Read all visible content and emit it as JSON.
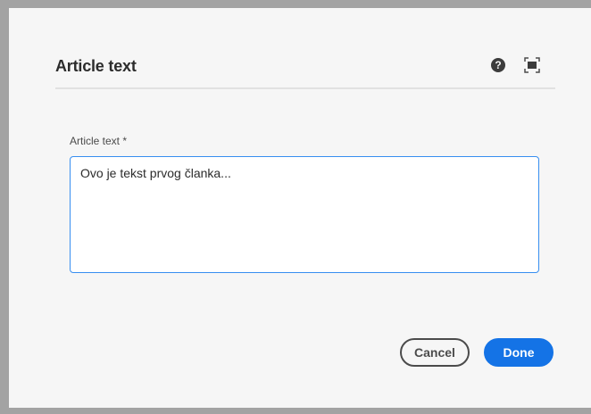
{
  "dialog": {
    "title": "Article text",
    "help_icon": "help-icon",
    "fullscreen_icon": "fullscreen-icon"
  },
  "field": {
    "label": "Article text *",
    "value": "Ovo je tekst prvog članka..."
  },
  "buttons": {
    "cancel_label": "Cancel",
    "done_label": "Done"
  },
  "colors": {
    "accent": "#1473e6",
    "focus_border": "#378ef0",
    "dialog_bg": "#f6f6f6",
    "backdrop": "#a3a3a3"
  }
}
